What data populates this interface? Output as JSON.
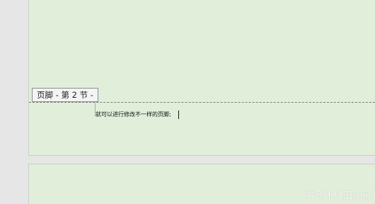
{
  "document": {
    "footer_tag_label": "页脚 - 第 2 节 -",
    "footer_text": "就可以进行修改不一样的页脚;"
  },
  "watermark": {
    "text": "爱创根知识网"
  },
  "colors": {
    "page_background": "#e1efda",
    "canvas_background": "#e6e6e6"
  }
}
